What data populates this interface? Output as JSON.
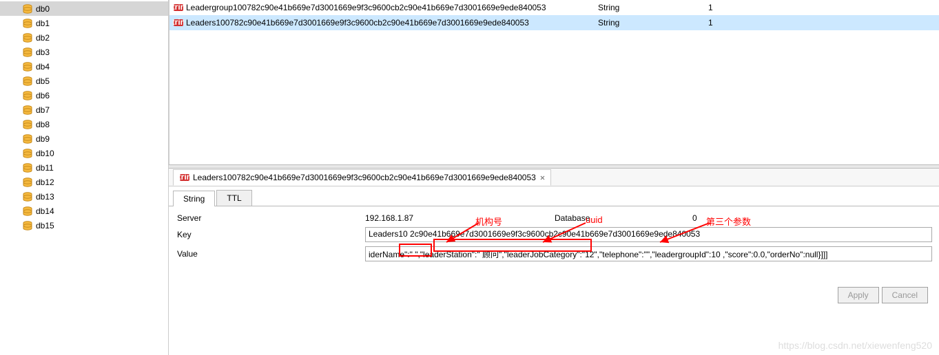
{
  "sidebar": {
    "items": [
      {
        "label": "db0",
        "selected": true
      },
      {
        "label": "db1"
      },
      {
        "label": "db2"
      },
      {
        "label": "db3"
      },
      {
        "label": "db4"
      },
      {
        "label": "db5"
      },
      {
        "label": "db6"
      },
      {
        "label": "db7"
      },
      {
        "label": "db8"
      },
      {
        "label": "db9"
      },
      {
        "label": "db10"
      },
      {
        "label": "db11"
      },
      {
        "label": "db12"
      },
      {
        "label": "db13"
      },
      {
        "label": "db14"
      },
      {
        "label": "db15"
      }
    ]
  },
  "grid": {
    "rows": [
      {
        "name": "Leadergroup100782c90e41b669e7d3001669e9f3c9600cb2c90e41b669e7d3001669e9ede840053",
        "type": "String",
        "count": "1",
        "selected": false
      },
      {
        "name": "Leaders100782c90e41b669e7d3001669e9f3c9600cb2c90e41b669e7d3001669e9ede840053",
        "type": "String",
        "count": "1",
        "selected": true
      }
    ]
  },
  "editor": {
    "tab_title": "Leaders100782c90e41b669e7d3001669e9f3c9600cb2c90e41b669e7d3001669e9ede840053",
    "close_glyph": "✕",
    "subtabs": [
      {
        "label": "String",
        "active": true
      },
      {
        "label": "TTL",
        "active": false
      }
    ],
    "form": {
      "server_label": "Server",
      "server_value": "192.168.1.87",
      "database_label": "Database",
      "database_value": "0",
      "key_label": "Key",
      "key_value": "Leaders10    2c90e41b669e7d3001669e9f3c9600cb2c90e41b669e7d3001669e9ede840053",
      "value_label": "Value",
      "value_value": "iderName\":\"   \",\"leaderStation\":\"    顾问\",\"leaderJobCategory\":\"12\",\"telephone\":\"\",\"leadergroupId\":10   ,\"score\":0.0,\"orderNo\":null}]]]"
    },
    "buttons": {
      "apply": "Apply",
      "cancel": "Cancel"
    }
  },
  "annotations": {
    "a1": "机构号",
    "a2": "uuid",
    "a3": "第三个参数"
  },
  "watermark": "https://blog.csdn.net/xiewenfeng520"
}
